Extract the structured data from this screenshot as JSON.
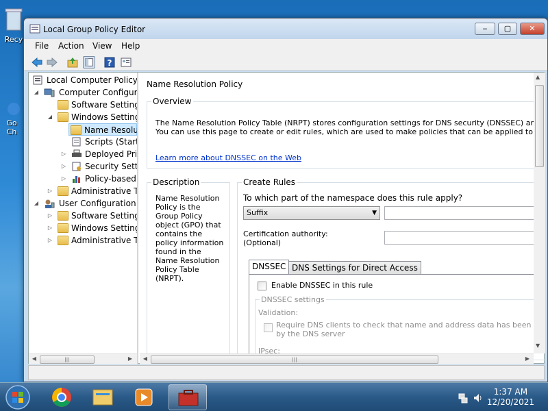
{
  "desktop": {
    "recycle_label": "Recy",
    "chrome_label_1": "Go",
    "chrome_label_2": "Ch"
  },
  "window": {
    "title": "Local Group Policy Editor",
    "minimize": "‒",
    "maximize": "▢",
    "close": "✕"
  },
  "menu": {
    "file": "File",
    "action": "Action",
    "view": "View",
    "help": "Help"
  },
  "toolbar": {
    "icons": [
      "back-arrow-icon",
      "forward-arrow-icon",
      "up-folder-icon",
      "show-hide-tree-icon",
      "help-icon",
      "properties-icon"
    ]
  },
  "tree": {
    "items": [
      {
        "label": "Local Computer Policy",
        "icon": "policy-icon"
      },
      {
        "label": "Computer Configura",
        "icon": "computer-icon"
      },
      {
        "label": "Software Settings",
        "icon": "folder-icon"
      },
      {
        "label": "Windows Setting",
        "icon": "folder-icon"
      },
      {
        "label": "Name Resolu",
        "icon": "folder-icon"
      },
      {
        "label": "Scripts (Startu",
        "icon": "script-icon"
      },
      {
        "label": "Deployed Prir",
        "icon": "printer-icon"
      },
      {
        "label": "Security Settin",
        "icon": "security-icon"
      },
      {
        "label": "Policy-based",
        "icon": "chart-icon"
      },
      {
        "label": "Administrative Te",
        "icon": "folder-icon"
      },
      {
        "label": "User Configuration",
        "icon": "user-icon"
      },
      {
        "label": "Software Settings",
        "icon": "folder-icon"
      },
      {
        "label": "Windows Setting",
        "icon": "folder-icon"
      },
      {
        "label": "Administrative Te",
        "icon": "folder-icon"
      }
    ]
  },
  "panel": {
    "title": "Name Resolution Policy",
    "overview": {
      "legend": "Overview",
      "line1": "The Name Resolution Policy Table (NRPT) stores configuration settings for DNS security (DNSSEC) and Direct Acce",
      "line2": "You can use this page to create or edit rules, which are used to make policies that can be applied to an Active Direct",
      "link": "Learn more about DNSSEC on the Web"
    },
    "description": {
      "legend": "Description",
      "text": "Name Resolution Policy is the Group Policy object (GPO) that contains the policy information found in the Name Resolution Policy Table (NRPT)."
    },
    "create_rules": {
      "legend": "Create Rules",
      "question": "To which part of the namespace does this rule apply?",
      "namespace_type": "Suffix",
      "cert_label_1": "Certification authority:",
      "cert_label_2": "(Optional)",
      "tabs": [
        "DNSSEC",
        "DNS Settings for Direct Access"
      ],
      "enable_dnssec": "Enable DNSSEC in this rule",
      "dnssec_settings_legend": "DNSSEC settings",
      "validation_label": "Validation:",
      "require_line1": "Require DNS clients to check that name and address data has been validated",
      "require_line2": "by the DNS server",
      "ipsec_label": "IPsec:"
    }
  },
  "taskbar": {
    "time": "1:37 AM",
    "date": "12/20/2021"
  },
  "colors": {
    "link": "#0033cc",
    "selection": "#cde8ff",
    "taskbar": "#2a5a88"
  }
}
